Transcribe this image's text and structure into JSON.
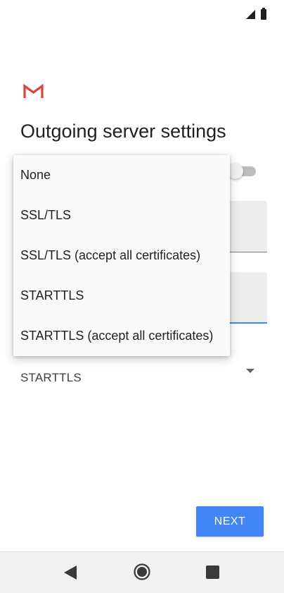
{
  "page": {
    "title": "Outgoing server settings"
  },
  "form": {
    "security_type_value": "STARTTLS"
  },
  "dropdown": {
    "options": [
      "None",
      "SSL/TLS",
      "SSL/TLS (accept all certificates)",
      "STARTTLS",
      "STARTTLS (accept all certificates)"
    ]
  },
  "buttons": {
    "next_label": "NEXT"
  },
  "icons": {
    "status": [
      "signal-icon",
      "battery-icon"
    ],
    "app": "gmail-logo",
    "navigation": [
      "back-icon",
      "home-icon",
      "recents-icon"
    ]
  },
  "colors": {
    "accent": "#4285f4",
    "gmail_red": "#db4437",
    "text_primary": "#202124"
  }
}
